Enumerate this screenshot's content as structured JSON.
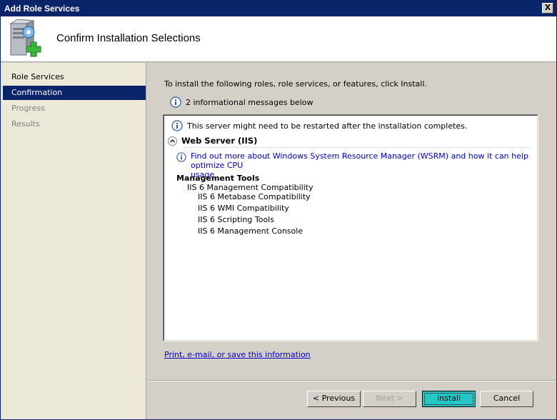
{
  "window": {
    "title": "Add Role Services",
    "close_glyph": "X"
  },
  "header": {
    "heading": "Confirm Installation Selections",
    "icon": "server-add-icon"
  },
  "nav": {
    "items": [
      {
        "label": "Role Services",
        "state": "normal"
      },
      {
        "label": "Confirmation",
        "state": "active"
      },
      {
        "label": "Progress",
        "state": "disabled"
      },
      {
        "label": "Results",
        "state": "disabled"
      }
    ]
  },
  "content": {
    "intro": "To install the following roles, role services, or features, click Install.",
    "message_count": "2 informational messages below",
    "list": {
      "restart_notice": "This server might need to be restarted after the installation completes.",
      "role_name": "Web Server (IIS)",
      "wsrm_link_line1": "Find out more about Windows System Resource Manager (WSRM) and how it can help optimize CPU",
      "wsrm_link_line2": "usage",
      "group_title": "Management Tools",
      "subgroup_title": "IIS 6 Management Compatibility",
      "features": [
        "IIS 6 Metabase Compatibility",
        "IIS 6 WMI Compatibility",
        "IIS 6 Scripting Tools",
        "IIS 6 Management Console"
      ]
    },
    "print_link": "Print, e-mail, or save this information"
  },
  "footer": {
    "previous_label": "< Previous",
    "next_label": "Next >",
    "install_label": "Install",
    "cancel_label": "Cancel"
  },
  "colors": {
    "titlebar": "#0a246a",
    "nav_active": "#0a246a",
    "install_button": "#22c7c7",
    "link": "#0000cc"
  }
}
